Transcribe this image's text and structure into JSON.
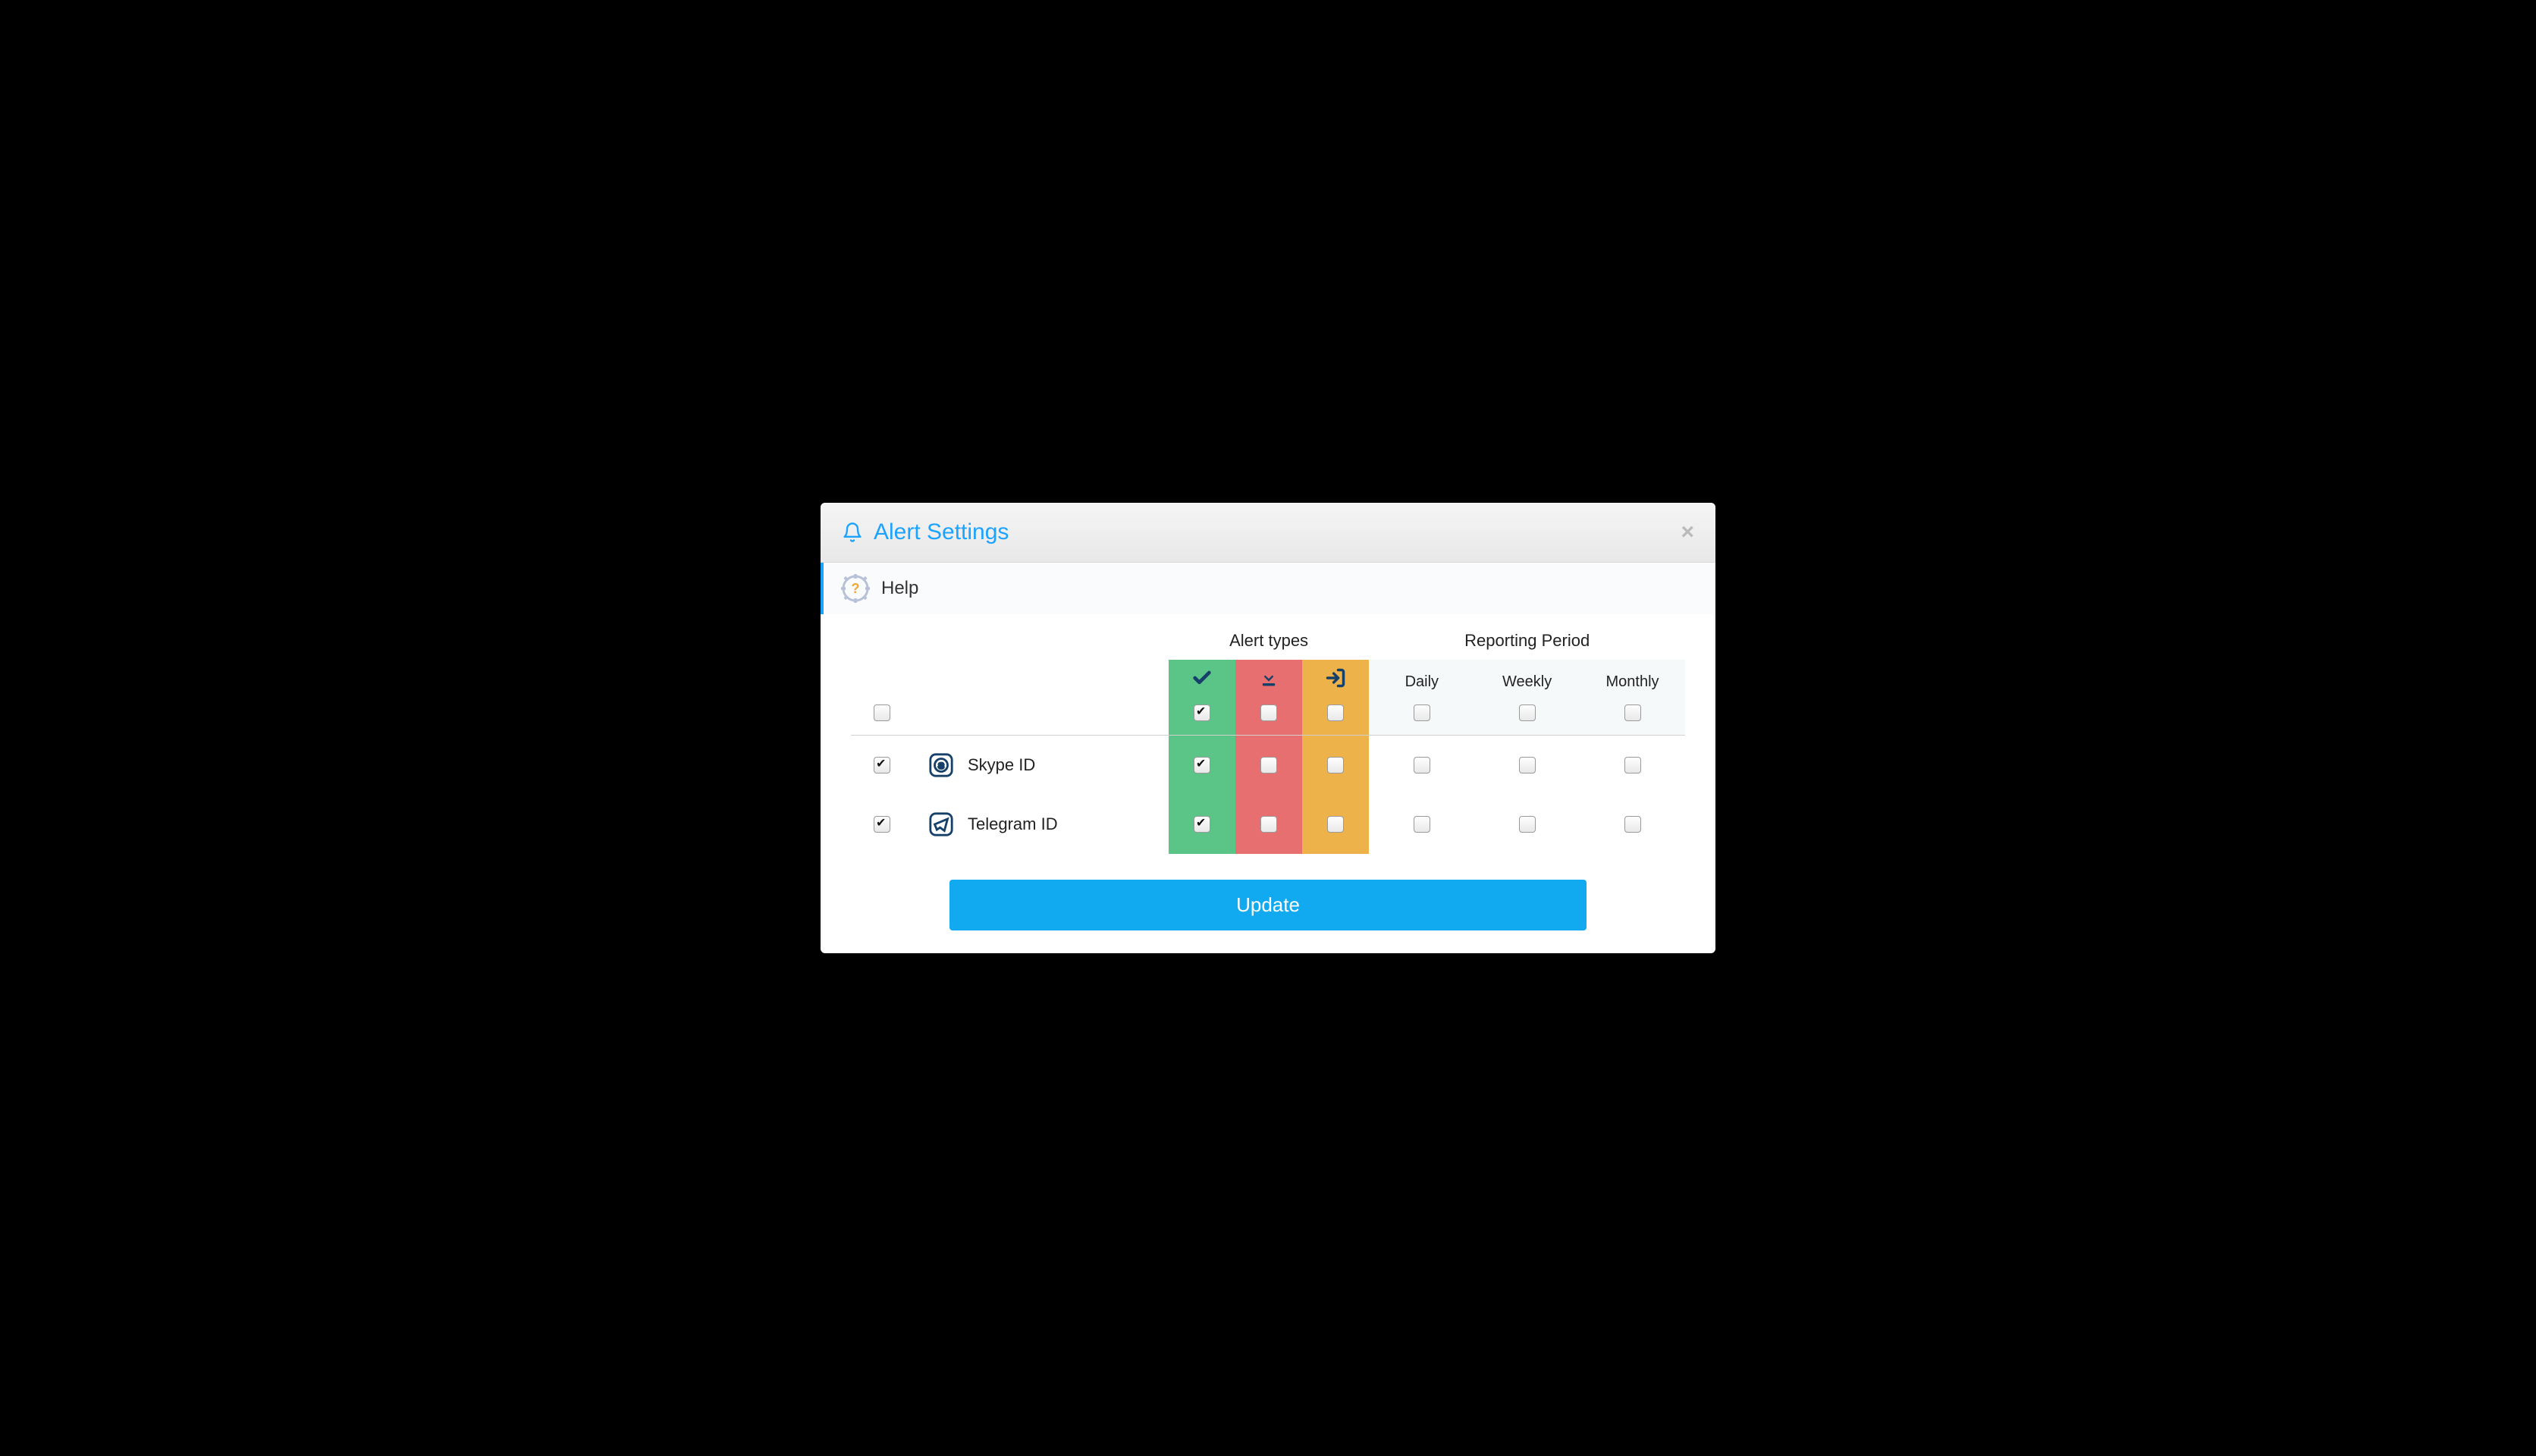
{
  "dialog": {
    "title": "Alert Settings",
    "close_label": "×"
  },
  "help": {
    "label": "Help"
  },
  "headers": {
    "alert_types": "Alert types",
    "reporting_period": "Reporting Period",
    "daily": "Daily",
    "weekly": "Weekly",
    "monthly": "Monthly"
  },
  "icons": {
    "bell": "bell-icon",
    "help_gear": "help-gear-icon",
    "check": "check-icon",
    "download": "download-icon",
    "login": "login-icon",
    "skype": "skype-icon",
    "telegram": "telegram-icon"
  },
  "colors": {
    "accent": "#1ba3ff",
    "green": "#5bc487",
    "red": "#e86f6f",
    "orange": "#eeb24a",
    "button": "#11a9f0"
  },
  "all_row": {
    "enable": false,
    "green": true,
    "red": false,
    "orange": false,
    "daily": false,
    "weekly": false,
    "monthly": false
  },
  "rows": [
    {
      "id": "skype",
      "label": "Skype ID",
      "enable": true,
      "green": true,
      "red": false,
      "orange": false,
      "daily": false,
      "weekly": false,
      "monthly": false
    },
    {
      "id": "telegram",
      "label": "Telegram ID",
      "enable": true,
      "green": true,
      "red": false,
      "orange": false,
      "daily": false,
      "weekly": false,
      "monthly": false
    }
  ],
  "actions": {
    "update": "Update"
  }
}
